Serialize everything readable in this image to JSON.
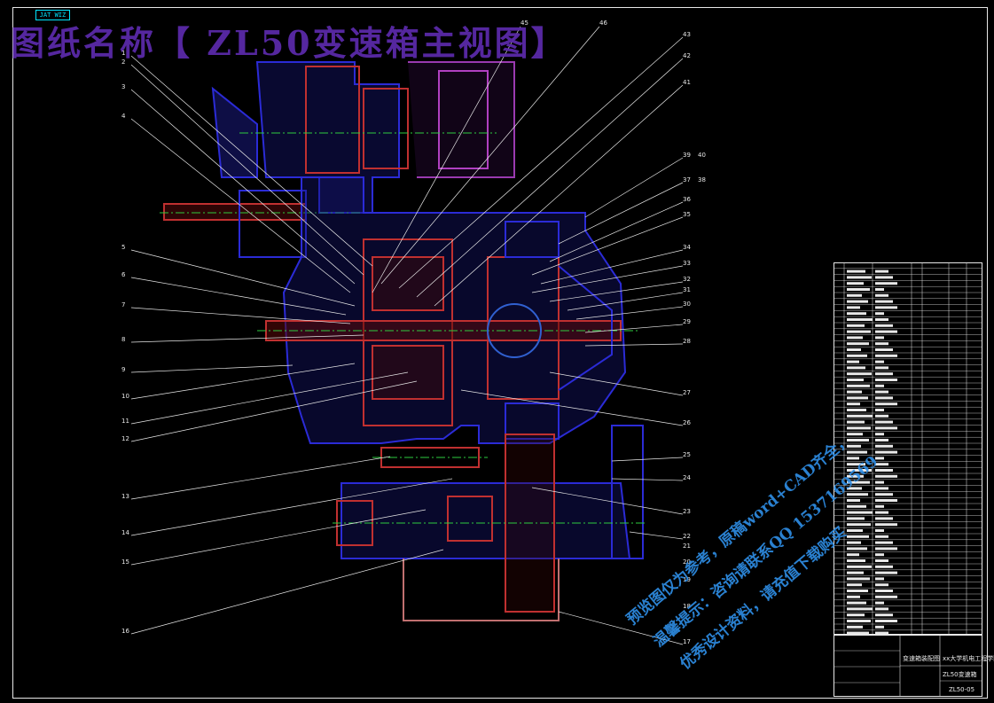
{
  "tag": "JAT WIZ",
  "title": "图纸名称【 ZL50变速箱主视图】",
  "left_labels": [
    "1",
    "2",
    "3",
    "4",
    "5",
    "6",
    "7",
    "8",
    "9",
    "10",
    "11",
    "12",
    "13",
    "14",
    "15",
    "16"
  ],
  "right_labels": [
    "40",
    "39",
    "37",
    "38",
    "36",
    "35",
    "34",
    "33",
    "32",
    "31",
    "30",
    "29",
    "28",
    "27",
    "26",
    "25",
    "24",
    "23",
    "22",
    "21",
    "20",
    "19",
    "18",
    "17"
  ],
  "top_labels": [
    "45",
    "46",
    "43",
    "42",
    "41"
  ],
  "title_block": {
    "assembly_name": "变速箱装配图",
    "school": "xx大学机电工程学院",
    "drawing_no": "ZL50-05",
    "designer": "ZL50变速箱"
  },
  "watermark": [
    "预览图仅为参考，原稿word+CAD齐全，",
    "温馨提示：咨询请联系QQ 1537169569",
    "优秀设计资料，请充值下载购买"
  ],
  "colors": {
    "housing": "#2222cc",
    "shaft": "#cc2222",
    "centerline": "#2ecc40",
    "leader": "#e8e8e8",
    "title": "#5a2aa8",
    "watermark": "#2f8fe8"
  }
}
